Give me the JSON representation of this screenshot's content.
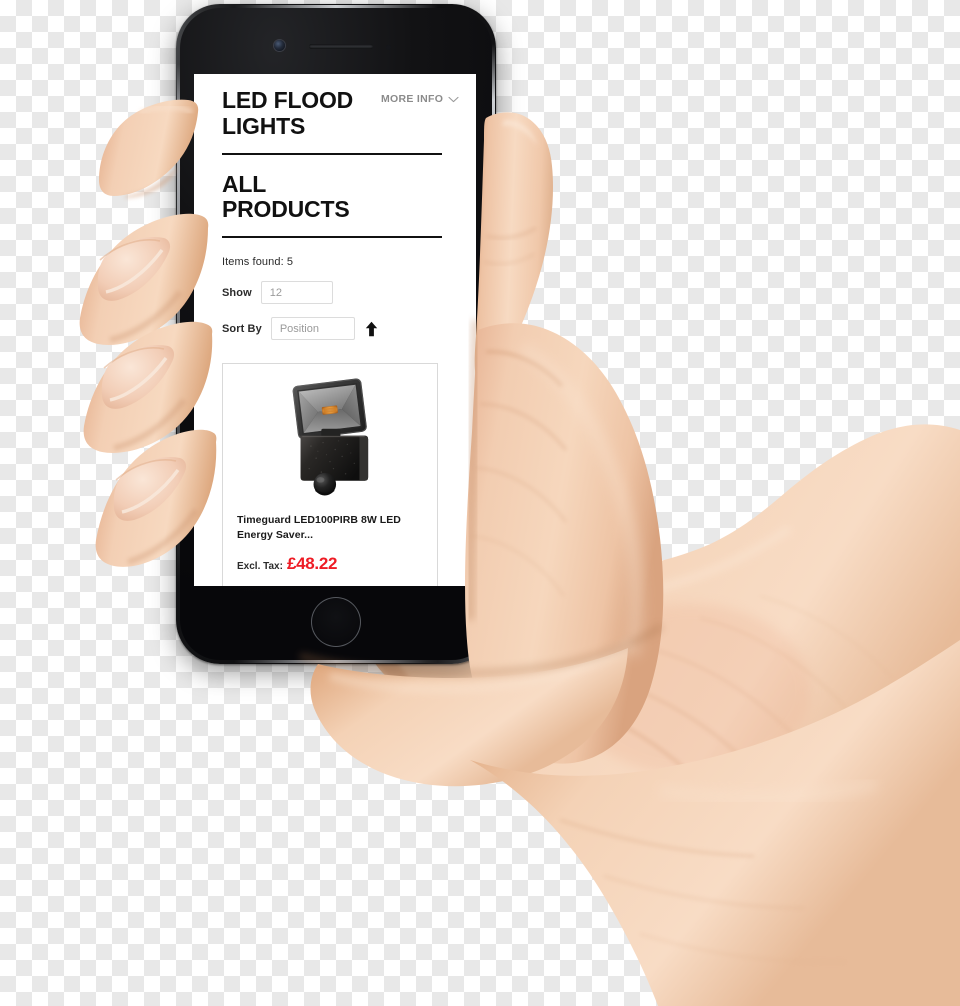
{
  "device": {
    "name": "smartphone-mockup",
    "body_color": "#0d0d0f",
    "bezel_rim_color": "#c9ccd1",
    "home_button": "home-button",
    "front_camera": "front-camera",
    "earpiece": "earpiece-speaker"
  },
  "screen": {
    "background": "#ffffff",
    "header": {
      "category_title": "LED FLOOD LIGHTS",
      "more_info_label": "MORE INFO",
      "more_info_icon": "chevron-down-icon",
      "more_info_color": "#8b8b8b"
    },
    "section": {
      "heading": "ALL PRODUCTS"
    },
    "toolbar": {
      "items_found": "Items found: 5",
      "show_label": "Show",
      "show_value": "12",
      "sort_label": "Sort By",
      "sort_value": "Position",
      "sort_direction_icon": "arrow-up-icon"
    },
    "products": [
      {
        "image_alt": "led-floodlight-with-pir-sensor",
        "title": "Timeguard LED100PIRB 8W LED Energy Saver...",
        "price_label": "Excl. Tax:",
        "price": "£48.22",
        "price_color": "#ee1c25"
      }
    ]
  },
  "hand": {
    "description": "right-hand-holding-phone",
    "skin_base": "#edbf9f",
    "skin_shadow": "#c79270",
    "nail_color": "#f0cdb4"
  }
}
